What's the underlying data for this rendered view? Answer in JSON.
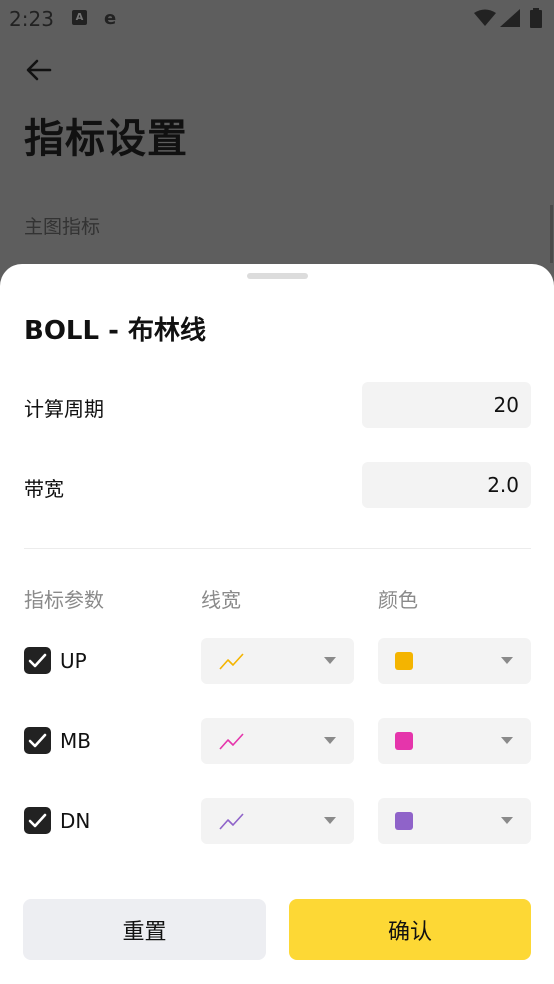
{
  "status_bar": {
    "time": "2:23",
    "a_glyph": "A",
    "e_glyph": "e"
  },
  "page": {
    "title": "指标设置",
    "section_label": "主图指标"
  },
  "sheet": {
    "title": "BOLL - 布林线",
    "period": {
      "label": "计算周期",
      "value": "20"
    },
    "bandwidth": {
      "label": "带宽",
      "value": "2.0"
    },
    "columns": {
      "param": "指标参数",
      "width": "线宽",
      "color": "颜色"
    },
    "rows": [
      {
        "label": "UP",
        "checked": true,
        "color": "#f4b400"
      },
      {
        "label": "MB",
        "checked": true,
        "color": "#e535ab"
      },
      {
        "label": "DN",
        "checked": true,
        "color": "#8f63c9"
      }
    ],
    "reset_label": "重置",
    "confirm_label": "确认"
  },
  "colors": {
    "accent": "#fdd835",
    "check_bg": "#222222",
    "field_bg": "#f3f3f3"
  }
}
